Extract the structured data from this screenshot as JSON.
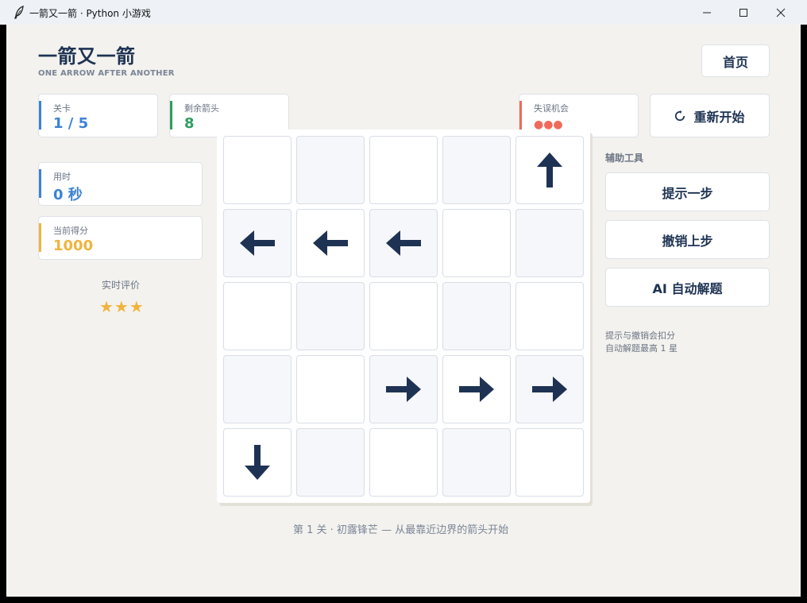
{
  "window": {
    "title": "一箭又一箭 · Python 小游戏"
  },
  "header": {
    "title": "一箭又一箭",
    "subtitle": "ONE ARROW AFTER ANOTHER",
    "home_label": "首页"
  },
  "stats": {
    "level": {
      "label": "关卡",
      "value": "1 / 5",
      "color": "#3b82d6"
    },
    "remaining": {
      "label": "剩余箭头",
      "value": "8",
      "color": "#2f9e5f"
    },
    "mistakes": {
      "label": "失误机会",
      "value": "●●●",
      "color": "#ef6a5a"
    },
    "time": {
      "label": "用时",
      "value": "0 秒",
      "color": "#3b82d6"
    },
    "score": {
      "label": "当前得分",
      "value": "1000",
      "color": "#f0b43d"
    }
  },
  "rating": {
    "label": "实时评价",
    "stars": "★★★"
  },
  "toolbar": {
    "restart_label": "重新开始",
    "tools_label": "辅助工具",
    "hint_label": "提示一步",
    "undo_label": "撤销上步",
    "ai_label": "AI 自动解题",
    "note_line1": "提示与撤销会扣分",
    "note_line2": "自动解题最高 1 星"
  },
  "board": {
    "rows": 5,
    "cols": 5,
    "arrows": [
      [
        "",
        "",
        "",
        "",
        "up"
      ],
      [
        "left",
        "left",
        "left",
        "",
        ""
      ],
      [
        "",
        "",
        "",
        "",
        ""
      ],
      [
        "",
        "",
        "right",
        "right",
        "right"
      ],
      [
        "down",
        "",
        "",
        "",
        ""
      ]
    ],
    "arrow_color": "#1e3353"
  },
  "footer": {
    "caption": "第 1 关 · 初露锋芒 — 从最靠近边界的箭头开始"
  }
}
